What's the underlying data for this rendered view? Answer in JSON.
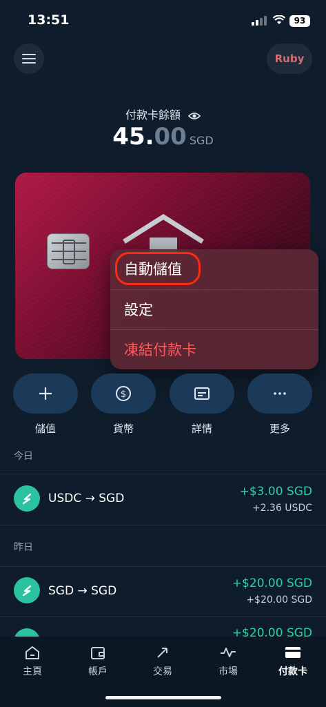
{
  "status": {
    "time": "13:51",
    "battery": "93"
  },
  "header": {
    "profile_label": "Ruby"
  },
  "balance": {
    "label": "付款卡餘額",
    "integer": "45.",
    "decimals": "00",
    "currency": "SGD"
  },
  "popup": {
    "items": [
      "自動儲值",
      "設定",
      "凍結付款卡"
    ]
  },
  "actions": [
    {
      "label": "儲值",
      "icon": "plus-icon"
    },
    {
      "label": "貨幣",
      "icon": "dollar-circle-icon"
    },
    {
      "label": "詳情",
      "icon": "card-details-icon"
    },
    {
      "label": "更多",
      "icon": "more-dots-icon"
    }
  ],
  "sections": {
    "today": "今日",
    "yesterday": "昨日"
  },
  "transactions": [
    {
      "title": "USDC → SGD",
      "amount": "+$3.00 SGD",
      "sub": "+2.36 USDC"
    },
    {
      "title": "SGD → SGD",
      "amount": "+$20.00 SGD",
      "sub": "+$20.00 SGD"
    },
    {
      "title": "",
      "amount": "+$20.00 SGD",
      "sub": ""
    }
  ],
  "tabs": [
    {
      "label": "主頁",
      "icon": "home-icon"
    },
    {
      "label": "帳戶",
      "icon": "wallet-icon"
    },
    {
      "label": "交易",
      "icon": "swap-arrows-icon"
    },
    {
      "label": "市場",
      "icon": "chart-line-icon"
    },
    {
      "label": "付款卡",
      "icon": "card-icon",
      "active": true
    }
  ],
  "colors": {
    "background": "#0f1c2b",
    "accent_green": "#2bd1a6",
    "danger_red": "#ff5a5a",
    "card_red": "#b01a48"
  }
}
